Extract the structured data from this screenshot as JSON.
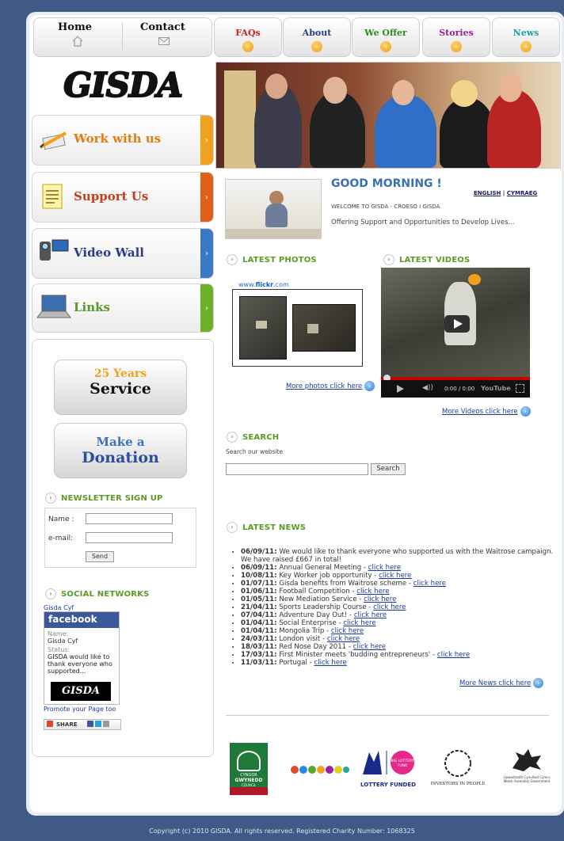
{
  "nav_left": [
    {
      "label": "Home",
      "icon": "home-icon"
    },
    {
      "label": "Contact",
      "icon": "mail-icon"
    }
  ],
  "nav_tabs": [
    {
      "label": "FAQs",
      "color": "#cc2222"
    },
    {
      "label": "About",
      "color": "#2b3a8c"
    },
    {
      "label": "We Offer",
      "color": "#2e8a1e"
    },
    {
      "label": "Stories",
      "color": "#a0209a"
    },
    {
      "label": "News",
      "color": "#1aa3a3"
    }
  ],
  "logo_text": "GISDA",
  "side_buttons": [
    {
      "label": "Work with us",
      "color": "#e07d10",
      "strip": "#f0a21e",
      "icon": "pen-icon"
    },
    {
      "label": "Support Us",
      "color": "#c0401a",
      "strip": "#e0601a",
      "icon": "document-icon"
    },
    {
      "label": "Video Wall",
      "color": "#2b3a8c",
      "strip": "#3a78c8",
      "icon": "camera-icon"
    },
    {
      "label": "Links",
      "color": "#5a9a25",
      "strip": "#6cb228",
      "icon": "laptop-icon"
    }
  ],
  "promo": {
    "years_top": "25 Years",
    "years_bottom": "Service",
    "donation_top": "Make a",
    "donation_bottom": "Donation"
  },
  "newsletter": {
    "heading": "NEWSLETTER SIGN UP",
    "name_label": "Name :",
    "email_label": "e-mail:",
    "send": "Send"
  },
  "social": {
    "heading": "SOCIAL NETWORKS",
    "owner": "Gisda Cyf",
    "brand": "facebook",
    "name_label": "Name:",
    "name_value": "Gisda Cyf",
    "status_label": "Status:",
    "status_text": "GISDA would like to thank everyone who supported...",
    "promote": "Promote your Page too",
    "share": "SHARE"
  },
  "welcome": {
    "greeting": "GOOD MORNING !",
    "lang_en": "ENGLISH",
    "lang_sep": "|",
    "lang_cy": "CYMRAEG",
    "subtitle": "WELCOME TO GISDA - CROESO I GISDA",
    "tagline": "Offering Support and Opportunities to Develop Lives..."
  },
  "photos": {
    "heading": "LATEST PHOTOS",
    "flickr_prefix": "www.",
    "flickr_brand": "flickr",
    "flickr_suffix": ".com",
    "more": "More photos click here"
  },
  "videos": {
    "heading": "LATEST VIDEOS",
    "time": "0:00 / 0:00",
    "youtube": "YouTube",
    "more": "More Videos click here"
  },
  "search": {
    "heading": "SEARCH",
    "caption": "Search our website",
    "button": "Search"
  },
  "news": {
    "heading": "LATEST NEWS",
    "link_text": "click here",
    "items": [
      {
        "date": "06/09/11:",
        "text": "We would like to thank everyone who supported us with the Waitrose campaign. We have raised £667 in total!",
        "link": false
      },
      {
        "date": "06/09/11:",
        "text": "Annual General Meeting -",
        "link": true
      },
      {
        "date": "10/08/11:",
        "text": "Key Worker job opportunity -",
        "link": true
      },
      {
        "date": "01/07/11:",
        "text": "Gisda benefits from Waitrose scheme -",
        "link": true
      },
      {
        "date": "01/06/11:",
        "text": "Football Competition -",
        "link": true
      },
      {
        "date": "01/05/11:",
        "text": "New Mediation Service -",
        "link": true
      },
      {
        "date": "21/04/11:",
        "text": "Sports Leadership Course -",
        "link": true
      },
      {
        "date": "07/04/11:",
        "text": "Adventure Day Out! -",
        "link": true
      },
      {
        "date": "01/04/11:",
        "text": "Social Enterprise -",
        "link": true
      },
      {
        "date": "01/04/11:",
        "text": "Mongolia Trip -",
        "link": true
      },
      {
        "date": "24/03/11:",
        "text": "London visit -",
        "link": true
      },
      {
        "date": "18/03/11:",
        "text": "Red Nose Day 2011 -",
        "link": true
      },
      {
        "date": "17/03/11:",
        "text": "First Minister meets 'budding entrepreneurs' -",
        "link": true
      },
      {
        "date": "11/03/11:",
        "text": "Portugal -",
        "link": true
      }
    ],
    "more": "More News click here"
  },
  "partners": {
    "gwynedd_top": "CYNGOR",
    "gwynedd_main": "GWYNEDD",
    "gwynedd_bottom": "COUNCIL",
    "lottery_label": "LOTTERY FUNDED",
    "big_lottery": "BIG LOTTERY FUND",
    "iip_label": "INVESTORS IN PEOPLE",
    "welsh_gov_line1": "Llywodraeth Cynulliad Cymru",
    "welsh_gov_line2": "Welsh Assembly Government"
  },
  "footer": "Copyright (c) 2010 GISDA. All rights reserved. Registered Charity Number: 1068325"
}
